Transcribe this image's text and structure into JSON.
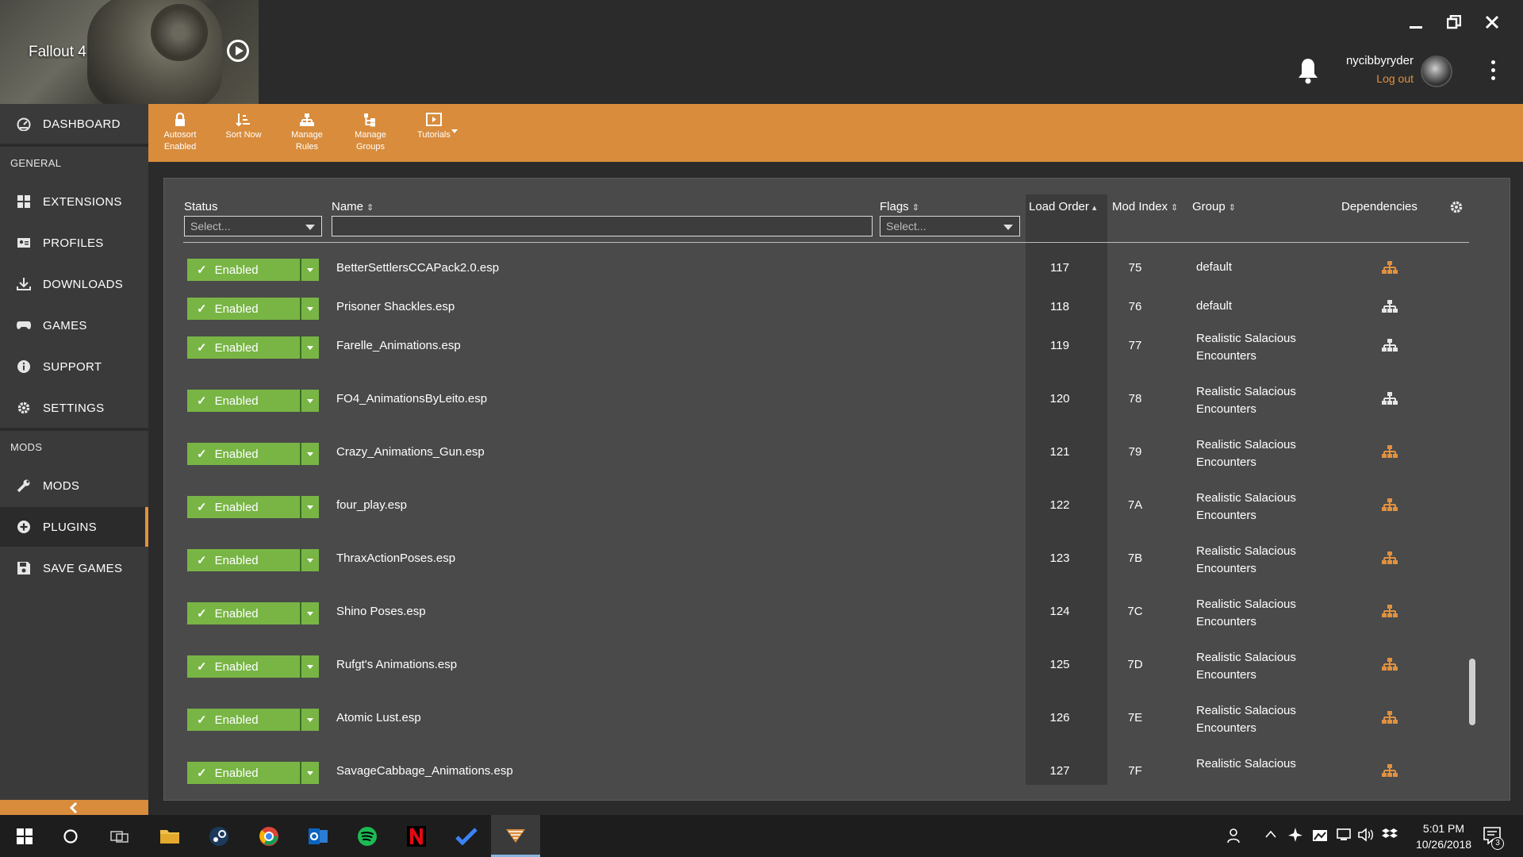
{
  "window": {
    "game_title": "Fallout 4",
    "username": "nycibbyryder",
    "logout_label": "Log out"
  },
  "sidebar": {
    "top_item": "DASHBOARD",
    "section_general": "GENERAL",
    "general_items": [
      "EXTENSIONS",
      "PROFILES",
      "DOWNLOADS",
      "GAMES",
      "SUPPORT",
      "SETTINGS"
    ],
    "section_mods": "MODS",
    "mods_items": [
      "MODS",
      "PLUGINS",
      "SAVE GAMES"
    ],
    "active_item": "PLUGINS"
  },
  "toolbar": {
    "autosort": "Autosort\nEnabled",
    "sort_now": "Sort Now",
    "manage_rules": "Manage\nRules",
    "manage_groups": "Manage\nGroups",
    "tutorials": "Tutorials"
  },
  "table": {
    "headers": {
      "status": "Status",
      "name": "Name",
      "flags": "Flags",
      "load_order": "Load Order",
      "mod_index": "Mod Index",
      "group": "Group",
      "dependencies": "Dependencies"
    },
    "status_filter_placeholder": "Select...",
    "flags_filter_placeholder": "Select...",
    "name_filter_value": "",
    "rows": [
      {
        "status": "Enabled",
        "name": "BetterSettlersCCAPack2.0.esp",
        "load": "117",
        "modidx": "75",
        "group": "default",
        "dep_color": "orange"
      },
      {
        "status": "Enabled",
        "name": "Prisoner Shackles.esp",
        "load": "118",
        "modidx": "76",
        "group": "default",
        "dep_color": "white"
      },
      {
        "status": "Enabled",
        "name": "Farelle_Animations.esp",
        "load": "119",
        "modidx": "77",
        "group": "Realistic Salacious Encounters",
        "dep_color": "white"
      },
      {
        "status": "Enabled",
        "name": "FO4_AnimationsByLeito.esp",
        "load": "120",
        "modidx": "78",
        "group": "Realistic Salacious Encounters",
        "dep_color": "white"
      },
      {
        "status": "Enabled",
        "name": "Crazy_Animations_Gun.esp",
        "load": "121",
        "modidx": "79",
        "group": "Realistic Salacious Encounters",
        "dep_color": "orange"
      },
      {
        "status": "Enabled",
        "name": "four_play.esp",
        "load": "122",
        "modidx": "7A",
        "group": "Realistic Salacious Encounters",
        "dep_color": "orange"
      },
      {
        "status": "Enabled",
        "name": "ThraxActionPoses.esp",
        "load": "123",
        "modidx": "7B",
        "group": "Realistic Salacious Encounters",
        "dep_color": "orange"
      },
      {
        "status": "Enabled",
        "name": "Shino Poses.esp",
        "load": "124",
        "modidx": "7C",
        "group": "Realistic Salacious Encounters",
        "dep_color": "orange"
      },
      {
        "status": "Enabled",
        "name": "Rufgt's Animations.esp",
        "load": "125",
        "modidx": "7D",
        "group": "Realistic Salacious Encounters",
        "dep_color": "orange"
      },
      {
        "status": "Enabled",
        "name": "Atomic Lust.esp",
        "load": "126",
        "modidx": "7E",
        "group": "Realistic Salacious Encounters",
        "dep_color": "orange"
      },
      {
        "status": "Enabled",
        "name": "SavageCabbage_Animations.esp",
        "load": "127",
        "modidx": "7F",
        "group": "Realistic Salacious",
        "dep_color": "orange"
      }
    ]
  },
  "colors": {
    "accent": "#d88c3c",
    "enabled": "#78b545",
    "dep_orange": "#e0913f",
    "dep_white": "#e6e6e6"
  },
  "taskbar": {
    "time": "5:01 PM",
    "date": "10/26/2018",
    "notifications": "3"
  }
}
